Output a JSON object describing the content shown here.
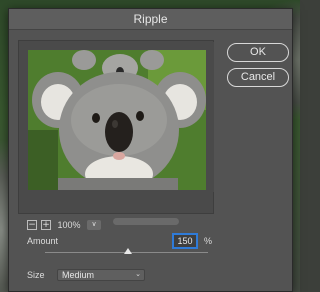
{
  "dialog": {
    "title": "Ripple",
    "ok_label": "OK",
    "cancel_label": "Cancel"
  },
  "preview": {
    "zoom_out_symbol": "−",
    "zoom_in_symbol": "+",
    "zoom_value": "100%",
    "zoom_dropdown_symbol": "∨",
    "subject": "koala"
  },
  "amount": {
    "label": "Amount",
    "value": "150",
    "unit": "%",
    "slider_level": 0.51
  },
  "size": {
    "label": "Size",
    "value": "Medium",
    "chevron": "⌄"
  },
  "colors": {
    "dialog_bg": "#535353",
    "focus_ring": "#2f7bd8"
  },
  "icons": [
    "zoom-out-icon",
    "zoom-in-icon",
    "chevron-down-icon"
  ]
}
